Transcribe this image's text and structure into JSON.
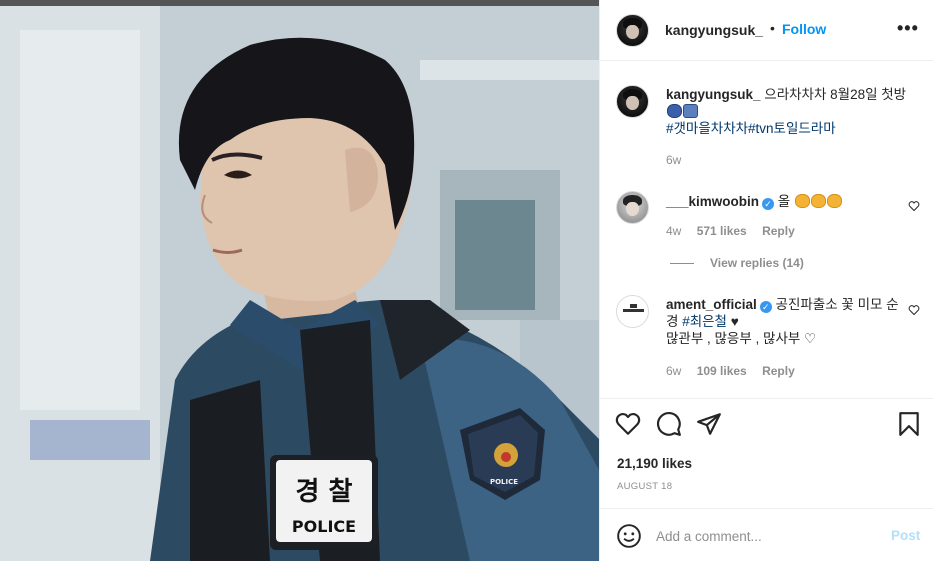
{
  "post": {
    "username": "kangyungsuk_",
    "follow_label": "Follow",
    "separator": "•",
    "more_label": "•••",
    "caption_text": "으라차차차 8월28일 첫방",
    "caption_tags": "#갯마을차차차#tvn토일드라마",
    "caption_age": "6w",
    "photo_patch_text_1": "경 찰",
    "photo_patch_text_2": "POLICE",
    "photo_badge_text": "POLICE"
  },
  "comments": [
    {
      "username": "___kimwoobin",
      "verified": true,
      "text": "올",
      "age": "4w",
      "likes": "571 likes",
      "reply_label": "Reply",
      "view_replies": "View replies (14)"
    },
    {
      "username": "ament_official",
      "verified": true,
      "text": "공진파출소 꽃 미모 순경",
      "tag": "#최은철",
      "text2": "♥",
      "line2": "많관부 , 많응부 , 많사부 ♡",
      "age": "6w",
      "likes": "109 likes",
      "reply_label": "Reply"
    }
  ],
  "actions": {
    "likes": "21,190 likes",
    "date": "AUGUST 18"
  },
  "add_comment": {
    "placeholder": "Add a comment...",
    "post_label": "Post"
  },
  "colors": {
    "accent": "#0095f6",
    "post_disabled": "#b2dffc",
    "tag": "#00376b",
    "muted": "#8e8e8e",
    "verified": "#3897f0"
  },
  "icons": [
    "more-icon",
    "heart-icon",
    "comment-icon",
    "share-icon",
    "bookmark-icon",
    "smile-icon",
    "heart-small-icon",
    "verified-icon"
  ]
}
